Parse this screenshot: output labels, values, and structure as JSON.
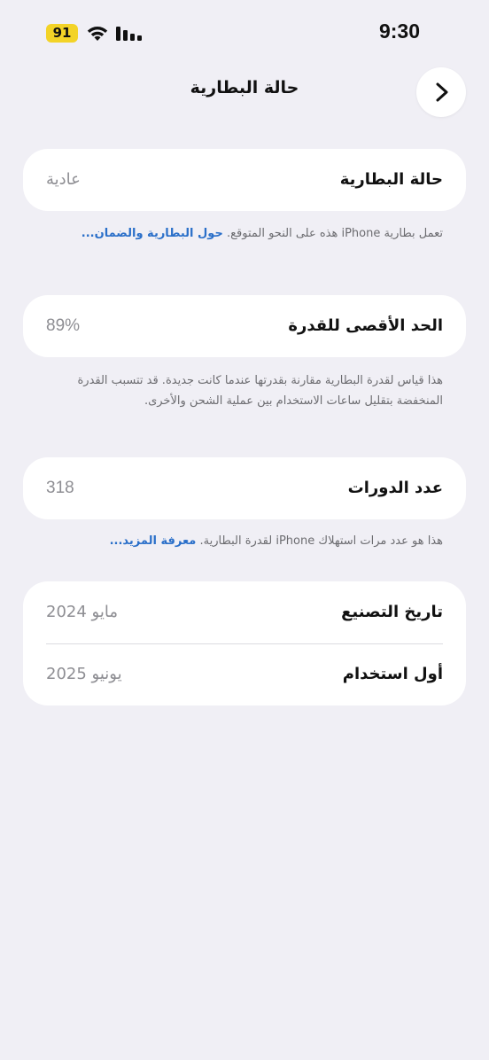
{
  "status_bar": {
    "battery_level": "91",
    "time": "9:30"
  },
  "nav": {
    "title": "حالة البطارية",
    "back_icon": "chevron-right-icon"
  },
  "battery_health": {
    "label": "حالة البطارية",
    "value": "عادية",
    "footnote_text": "تعمل بطارية iPhone هذه على النحو المتوقع.",
    "footnote_link": "حول البطارية والضمان..."
  },
  "max_capacity": {
    "label": "الحد الأقصى للقدرة",
    "value": "89%",
    "footnote_text": "هذا قياس لقدرة البطارية مقارنة بقدرتها عندما كانت جديدة. قد تتسبب القدرة المنخفضة بتقليل ساعات الاستخدام بين عملية الشحن والأخرى."
  },
  "cycle_count": {
    "label": "عدد الدورات",
    "value": "318",
    "footnote_text": "هذا هو عدد مرات استهلاك iPhone لقدرة البطارية.",
    "footnote_link": "معرفة المزيد..."
  },
  "dates": {
    "manufacture_label": "تاريخ التصنيع",
    "manufacture_value": "مايو 2024",
    "first_use_label": "أول استخدام",
    "first_use_value": "يونيو 2025"
  },
  "colors": {
    "background": "#f0eff5",
    "card": "#ffffff",
    "link": "#2a6fc9",
    "battery_badge": "#f3d327"
  }
}
